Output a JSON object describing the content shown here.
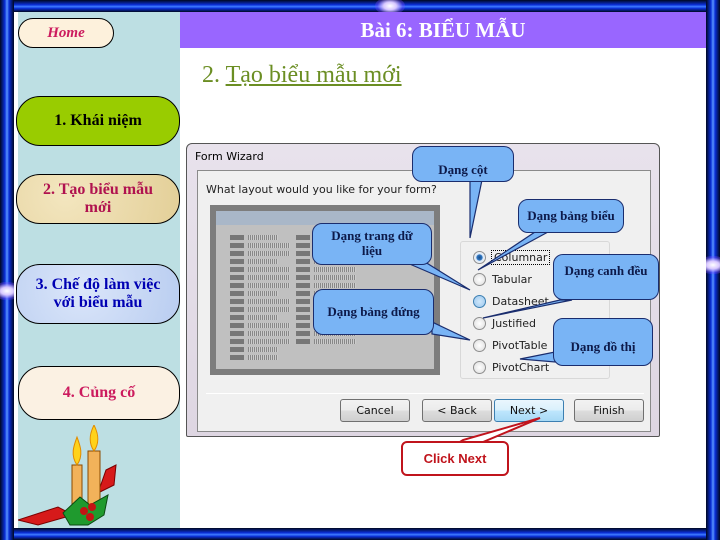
{
  "slide": {
    "header_title": "Bài 6: BIỂU MẪU",
    "subtitle_number": "2.",
    "subtitle_text": "Tạo biểu mẫu mới"
  },
  "sidebar": {
    "home_label": "Home",
    "items": [
      {
        "label": "1. Khái niệm"
      },
      {
        "label": "2. Tạo biểu mẫu mới"
      },
      {
        "label": "3. Chế độ làm việc với biểu mẫu"
      },
      {
        "label": "4. Củng cố"
      }
    ]
  },
  "dialog": {
    "title": "Form Wizard",
    "question": "What layout would you like for your form?",
    "options": [
      {
        "label": "Columnar",
        "checked": true
      },
      {
        "label": "Tabular",
        "checked": false
      },
      {
        "label": "Datasheet",
        "checked": false
      },
      {
        "label": "Justified",
        "checked": false
      },
      {
        "label": "PivotTable",
        "checked": false
      },
      {
        "label": "PivotChart",
        "checked": false
      }
    ],
    "buttons": {
      "cancel": "Cancel",
      "back": "< Back",
      "next": "Next >",
      "finish": "Finish"
    }
  },
  "callouts": {
    "columnar": "Dạng cột",
    "tabular": "Dạng bảng biểu",
    "datasheet": "Dạng trang dữ liệu",
    "justified": "Dạng canh đều",
    "pivottable": "Dạng bảng đứng",
    "pivotchart": "Dạng đồ thị",
    "click_next": "Click Next"
  },
  "colors": {
    "header_bg": "#9966ff",
    "sidebar_bg": "#bddfe3",
    "subtitle": "#6b8e23",
    "callout_bg": "#79b4f5",
    "click_next": "#c0141c"
  }
}
